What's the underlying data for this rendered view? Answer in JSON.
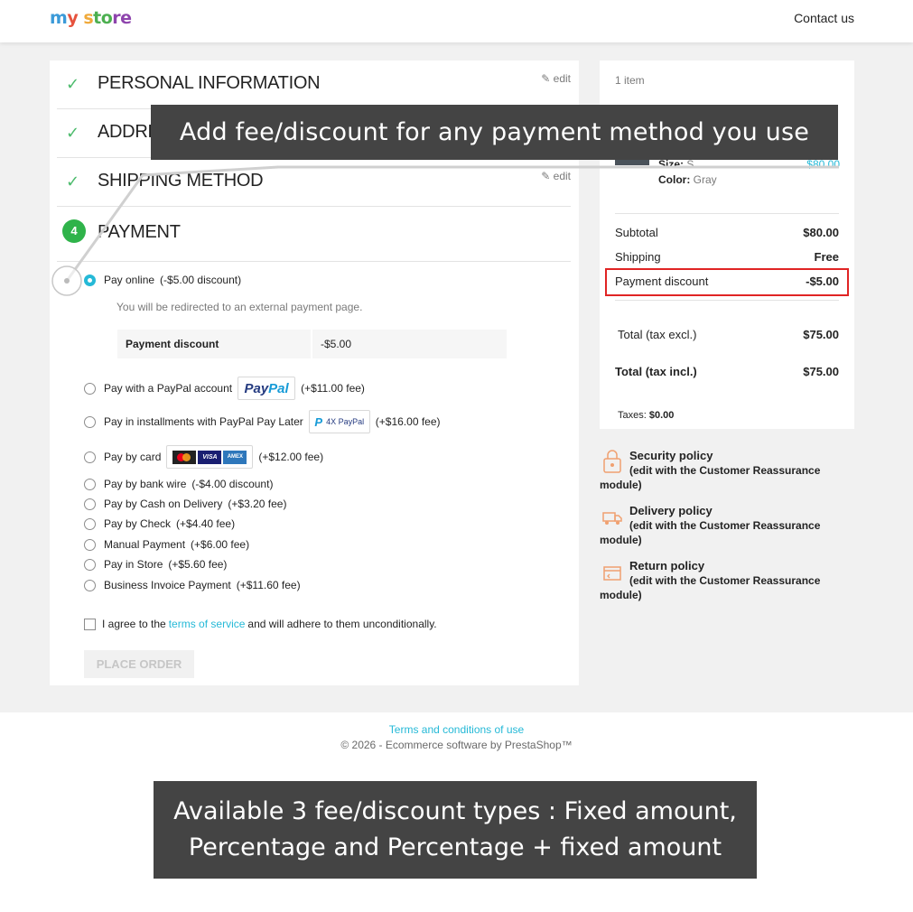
{
  "header": {
    "logo_parts": [
      "m",
      "y",
      " s",
      "to",
      "re"
    ],
    "contact_label": "Contact us"
  },
  "steps": [
    {
      "title": "PERSONAL INFORMATION",
      "edit_label": "edit"
    },
    {
      "title": "ADDRE"
    },
    {
      "title": "SHIPPING METHOD",
      "edit_label": "edit"
    },
    {
      "number": "4",
      "title": "PAYMENT"
    }
  ],
  "payment": {
    "options": [
      {
        "label": "Pay online",
        "fee": "(-$5.00 discount)",
        "selected": true
      },
      {
        "label": "Pay with a PayPal account",
        "fee": "(+$11.00 fee)"
      },
      {
        "label": "Pay in installments with PayPal Pay Later",
        "fee": "(+$16.00 fee)"
      },
      {
        "label": "Pay by card",
        "fee": "(+$12.00 fee)"
      },
      {
        "label": "Pay by bank wire",
        "fee": "(-$4.00 discount)"
      },
      {
        "label": "Pay by Cash on Delivery",
        "fee": "(+$3.20 fee)"
      },
      {
        "label": "Pay by Check",
        "fee": "(+$4.40 fee)"
      },
      {
        "label": "Manual Payment",
        "fee": "(+$6.00 fee)"
      },
      {
        "label": "Pay in Store",
        "fee": "(+$5.60 fee)"
      },
      {
        "label": "Business Invoice Payment",
        "fee": "(+$11.60 fee)"
      }
    ],
    "paypal_badge": {
      "p1": "Pay",
      "p2": "Pal"
    },
    "pay_later_badge": {
      "icon": "P",
      "text": "4X PayPal"
    },
    "card_logos": {
      "visa": "VISA",
      "amex": "AMEX"
    },
    "redirect_text": "You will be redirected to an external payment page.",
    "discount_table": {
      "label": "Payment discount",
      "value": "-$5.00"
    },
    "agree": {
      "before": "I agree to the",
      "link": "terms of service",
      "after": "and will adhere to them unconditionally."
    },
    "place_order_label": "PLACE ORDER"
  },
  "summary": {
    "items_count": "1 item",
    "size_label": "Size:",
    "size_value": "S",
    "color_label": "Color:",
    "color_value": "Gray",
    "product_price": "$80.00",
    "rows": [
      {
        "label": "Subtotal",
        "value": "$80.00"
      },
      {
        "label": "Shipping",
        "value": "Free"
      },
      {
        "label": "Payment discount",
        "value": "-$5.00"
      },
      {
        "label": "Total (tax excl.)",
        "value": "$75.00"
      },
      {
        "label": "Total (tax incl.)",
        "value": "$75.00"
      }
    ],
    "taxes_label": "Taxes:",
    "taxes_value": "$0.00"
  },
  "reassurance": [
    {
      "title": "Security policy",
      "line2": "(edit with the Customer Reassurance",
      "line3": "module)"
    },
    {
      "title": "Delivery policy",
      "line2": "(edit with the Customer Reassurance",
      "line3": "module)"
    },
    {
      "title": "Return policy",
      "line2": "(edit with the Customer Reassurance",
      "line3": "module)"
    }
  ],
  "footer": {
    "link": "Terms and conditions of use",
    "copyright": "© 2026 - Ecommerce software by PrestaShop™"
  },
  "overlays": {
    "top": "Add fee/discount for any payment method you use",
    "bottom_line1": "Available 3 fee/discount types : Fixed amount,",
    "bottom_line2": "Percentage and Percentage + fixed amount"
  },
  "colors": {
    "accent": "#25b9d7",
    "success": "#2fb34a",
    "highlight": "#e02424",
    "overlay": "#444444"
  }
}
